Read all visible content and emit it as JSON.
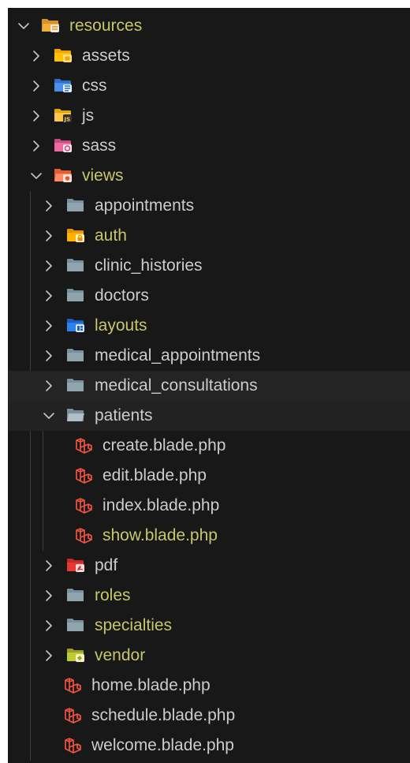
{
  "colors": {
    "background": "#181818",
    "text": "#cccccc",
    "modified_text": "#c6c76a",
    "row_highlight": "#242424",
    "indent_guide": "#3c3c3c"
  },
  "tree": [
    {
      "name": "resources",
      "depth": 0,
      "kind": "folder",
      "expanded": true,
      "icon": "folder-resource-open-icon",
      "modified": true
    },
    {
      "name": "assets",
      "depth": 1,
      "kind": "folder",
      "expanded": false,
      "icon": "folder-assets-icon",
      "modified": false
    },
    {
      "name": "css",
      "depth": 1,
      "kind": "folder",
      "expanded": false,
      "icon": "folder-css-icon",
      "modified": false
    },
    {
      "name": "js",
      "depth": 1,
      "kind": "folder",
      "expanded": false,
      "icon": "folder-js-icon",
      "modified": false
    },
    {
      "name": "sass",
      "depth": 1,
      "kind": "folder",
      "expanded": false,
      "icon": "folder-sass-icon",
      "modified": false
    },
    {
      "name": "views",
      "depth": 1,
      "kind": "folder",
      "expanded": true,
      "icon": "folder-views-open-icon",
      "modified": true
    },
    {
      "name": "appointments",
      "depth": 2,
      "kind": "folder",
      "expanded": false,
      "icon": "folder-icon",
      "modified": false
    },
    {
      "name": "auth",
      "depth": 2,
      "kind": "folder",
      "expanded": false,
      "icon": "folder-auth-icon",
      "modified": true
    },
    {
      "name": "clinic_histories",
      "depth": 2,
      "kind": "folder",
      "expanded": false,
      "icon": "folder-icon",
      "modified": false
    },
    {
      "name": "doctors",
      "depth": 2,
      "kind": "folder",
      "expanded": false,
      "icon": "folder-icon",
      "modified": false
    },
    {
      "name": "layouts",
      "depth": 2,
      "kind": "folder",
      "expanded": false,
      "icon": "folder-layouts-icon",
      "modified": true
    },
    {
      "name": "medical_appointments",
      "depth": 2,
      "kind": "folder",
      "expanded": false,
      "icon": "folder-icon",
      "modified": false
    },
    {
      "name": "medical_consultations",
      "depth": 2,
      "kind": "folder",
      "expanded": false,
      "icon": "folder-icon",
      "modified": false,
      "highlight": true
    },
    {
      "name": "patients",
      "depth": 2,
      "kind": "folder",
      "expanded": true,
      "icon": "folder-open-icon",
      "modified": false,
      "highlight": true
    },
    {
      "name": "create.blade.php",
      "depth": 3,
      "kind": "file",
      "icon": "laravel-blade-icon",
      "modified": false
    },
    {
      "name": "edit.blade.php",
      "depth": 3,
      "kind": "file",
      "icon": "laravel-blade-icon",
      "modified": false
    },
    {
      "name": "index.blade.php",
      "depth": 3,
      "kind": "file",
      "icon": "laravel-blade-icon",
      "modified": false
    },
    {
      "name": "show.blade.php",
      "depth": 3,
      "kind": "file",
      "icon": "laravel-blade-icon",
      "modified": true
    },
    {
      "name": "pdf",
      "depth": 2,
      "kind": "folder",
      "expanded": false,
      "icon": "folder-pdf-icon",
      "modified": false
    },
    {
      "name": "roles",
      "depth": 2,
      "kind": "folder",
      "expanded": false,
      "icon": "folder-icon",
      "modified": true
    },
    {
      "name": "specialties",
      "depth": 2,
      "kind": "folder",
      "expanded": false,
      "icon": "folder-icon",
      "modified": true
    },
    {
      "name": "vendor",
      "depth": 2,
      "kind": "folder",
      "expanded": false,
      "icon": "folder-vendor-icon",
      "modified": true
    },
    {
      "name": "home.blade.php",
      "depth": 2,
      "kind": "file",
      "icon": "laravel-blade-icon",
      "modified": false
    },
    {
      "name": "schedule.blade.php",
      "depth": 2,
      "kind": "file",
      "icon": "laravel-blade-icon",
      "modified": false
    },
    {
      "name": "welcome.blade.php",
      "depth": 2,
      "kind": "file",
      "icon": "laravel-blade-icon",
      "modified": false
    }
  ]
}
